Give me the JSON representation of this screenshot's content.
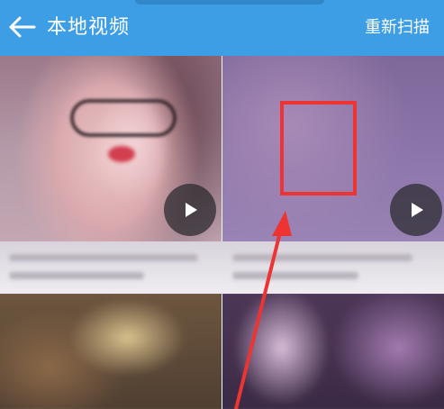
{
  "header": {
    "title": "本地视频",
    "rescan_label": "重新扫描",
    "back_icon": "arrow-left-icon",
    "background_color": "#3d9ee6"
  },
  "videos": [
    {
      "thumbnail": "blurred-portrait",
      "play_icon": "play-icon"
    },
    {
      "thumbnail": "blurred-purple",
      "play_icon": "play-icon"
    },
    {
      "thumbnail": "blurred-warm"
    },
    {
      "thumbnail": "blurred-dark-purple"
    }
  ],
  "annotation": {
    "color": "#ee3333",
    "icon": "pointer-arrow-icon"
  }
}
